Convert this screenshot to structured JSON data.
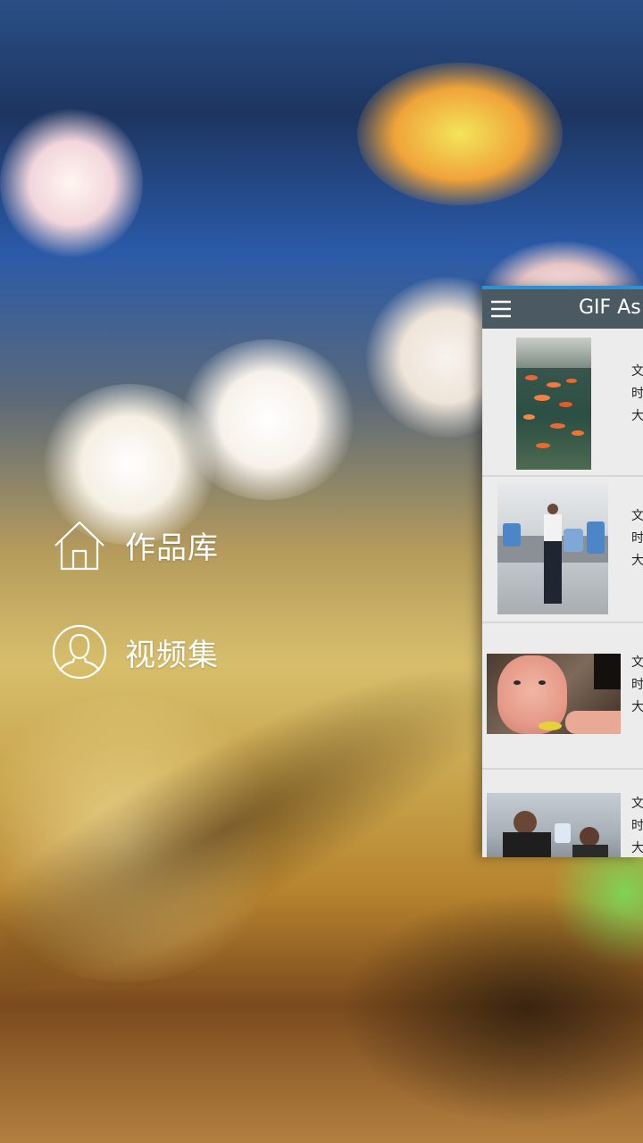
{
  "drawer": {
    "items": [
      {
        "label": "作品库",
        "icon": "home-icon"
      },
      {
        "label": "视频集",
        "icon": "user-icon"
      }
    ]
  },
  "app": {
    "title": "GIF As",
    "toolbar_color": "#4a5962",
    "accent": "#2f8fd6"
  },
  "list": {
    "items": [
      {
        "thumb": "koi-fish-pond",
        "lines": [
          "文",
          "时",
          "大"
        ]
      },
      {
        "thumb": "kitchen-worker",
        "lines": [
          "文",
          "时",
          "大"
        ]
      },
      {
        "thumb": "baby-eating",
        "lines": [
          "文",
          "时",
          "大"
        ]
      },
      {
        "thumb": "subway-people",
        "lines": [
          "文",
          "时",
          "大"
        ]
      }
    ]
  }
}
